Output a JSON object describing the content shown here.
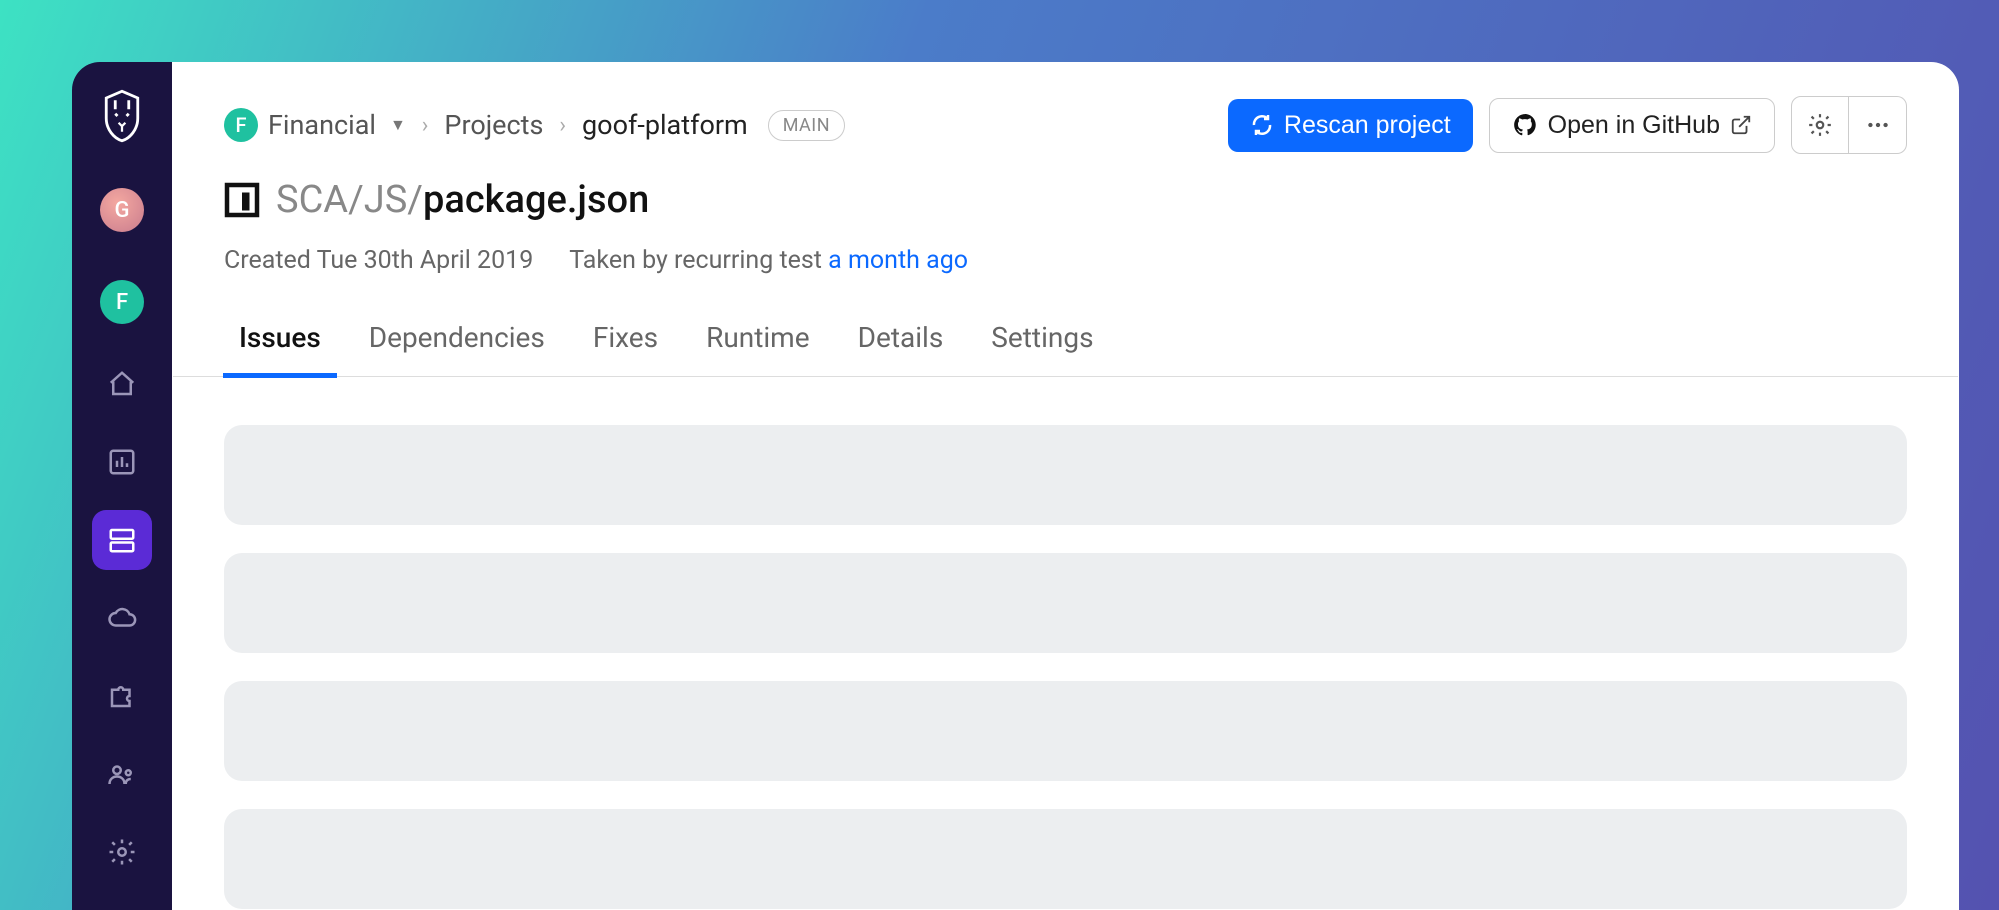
{
  "sidebar": {
    "avatar1_letter": "G",
    "avatar2_letter": "F"
  },
  "breadcrumb": {
    "org_letter": "F",
    "org_name": "Financial",
    "projects_label": "Projects",
    "project_name": "goof-platform",
    "branch_badge": "MAIN"
  },
  "actions": {
    "rescan_label": "Rescan project",
    "open_github_label": "Open in GitHub"
  },
  "title": {
    "prefix": "SCA/JS/",
    "file": "package.json"
  },
  "meta": {
    "created_label": "Created Tue 30th April 2019",
    "taken_label": "Taken by recurring test ",
    "taken_link": "a month ago"
  },
  "tabs": {
    "issues": "Issues",
    "dependencies": "Dependencies",
    "fixes": "Fixes",
    "runtime": "Runtime",
    "details": "Details",
    "settings": "Settings"
  }
}
